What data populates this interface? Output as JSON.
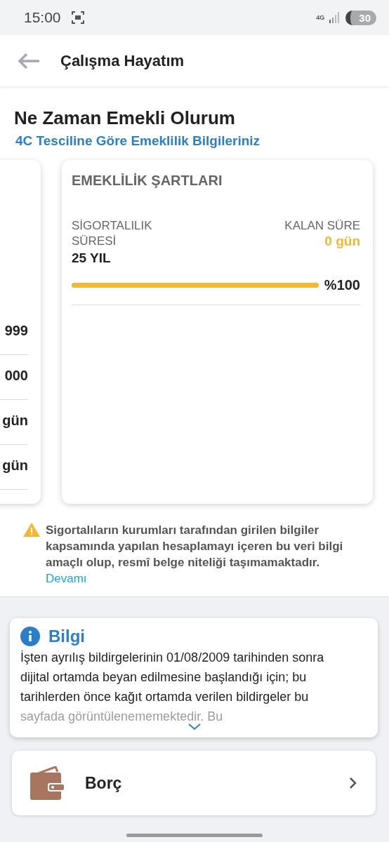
{
  "status_bar": {
    "time": "15:00",
    "network": "4G",
    "battery": "30"
  },
  "app_bar": {
    "title": "Çalışma Hayatım"
  },
  "header": {
    "title": "Ne Zaman Emekli Olurum",
    "subtitle": "4C Tesciline Göre Emeklilik Bilgileriniz"
  },
  "previous_card": {
    "values": [
      "999",
      "000",
      "gün",
      "gün"
    ]
  },
  "conditions_card": {
    "title": "EMEKLİLİK ŞARTLARI",
    "left_label": "SİGORTALILIK SÜRESİ",
    "left_value": "25 YIL",
    "right_label": "KALAN SÜRE",
    "right_value": "0 gün",
    "level": 1,
    "reading": "%100"
  },
  "notice": {
    "text": "Sigortalıların kurumları tarafından girilen bilgiler kapsamında yapılan hesaplamayı içeren bu veri bilgi amaçlı olup, resmî belge niteliği taşımamaktadır.",
    "link": "Devamı"
  },
  "info_card": {
    "title": "Bilgi",
    "text": "İşten ayrılış bildirgelerinin 01/08/2009 tarihinden sonra dijital ortamda beyan edilmesine başlandığı için; bu tarihlerden önce kağıt ortamda verilen bildirgeler bu sayfada görüntülenememektedir. Bu",
    "expanded": false
  },
  "menu": [
    {
      "label": "Borç"
    }
  ]
}
